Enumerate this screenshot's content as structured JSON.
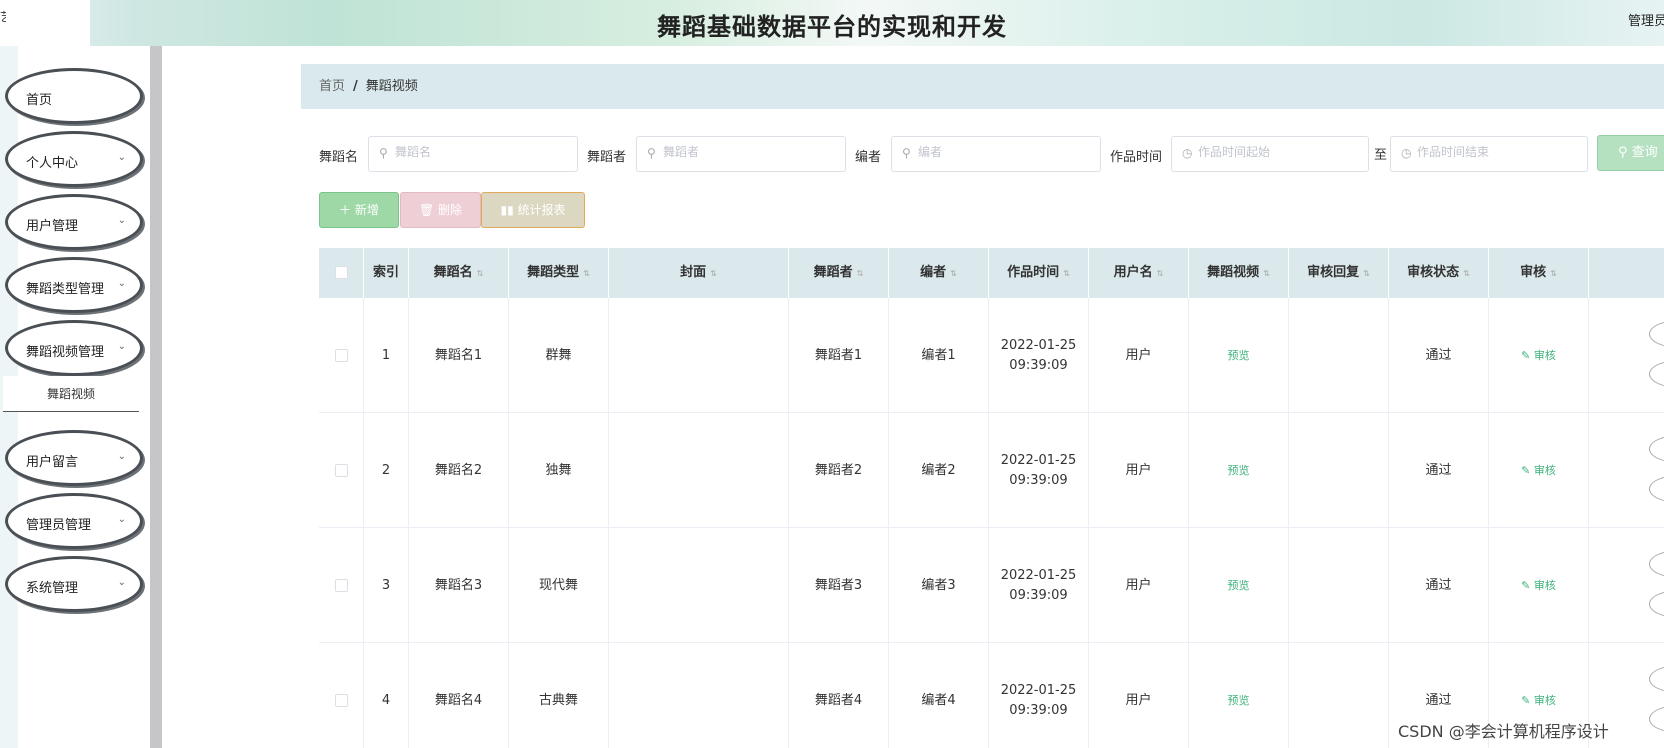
{
  "header": {
    "title": "舞蹈基础数据平台的实现和开发",
    "user_label": "管理员",
    "left_char": "艺"
  },
  "sidebar": {
    "items": [
      {
        "label": "首页",
        "has_caret": false
      },
      {
        "label": "个人中心",
        "has_caret": true
      },
      {
        "label": "用户管理",
        "has_caret": true
      },
      {
        "label": "舞蹈类型管理",
        "has_caret": true
      },
      {
        "label": "舞蹈视频管理",
        "has_caret": true
      },
      {
        "label": "用户留言",
        "has_caret": true
      },
      {
        "label": "管理员管理",
        "has_caret": true
      },
      {
        "label": "系统管理",
        "has_caret": true
      }
    ],
    "submenu": {
      "label": "舞蹈视频"
    },
    "caret_glyph": "⌄"
  },
  "breadcrumb": {
    "home": "首页",
    "separator": "/",
    "current": "舞蹈视频"
  },
  "search": {
    "fields": [
      {
        "label": "舞蹈名",
        "placeholder": "舞蹈名",
        "value": ""
      },
      {
        "label": "舞蹈者",
        "placeholder": "舞蹈者",
        "value": ""
      },
      {
        "label": "编者",
        "placeholder": "编者",
        "value": ""
      },
      {
        "label": "作品时间",
        "placeholder": "作品时间起始",
        "value": ""
      }
    ],
    "range_separator": "至",
    "end_placeholder": "作品时间结束",
    "button_label": "查询"
  },
  "actions": {
    "add": "新增",
    "delete": "删除",
    "report": "统计报表"
  },
  "table": {
    "headers": [
      "",
      "索引",
      "舞蹈名",
      "舞蹈类型",
      "封面",
      "舞蹈者",
      "编者",
      "作品时间",
      "用户名",
      "舞蹈视频",
      "审核回复",
      "审核状态",
      "审核"
    ],
    "rows": [
      {
        "index": "1",
        "name": "舞蹈名1",
        "type": "群舞",
        "cover": "",
        "dancer": "舞蹈者1",
        "editor": "编者1",
        "date": "2022-01-25",
        "time": "09:39:09",
        "user": "用户",
        "video": "预览",
        "reply": "",
        "status": "通过",
        "audit": "审核"
      },
      {
        "index": "2",
        "name": "舞蹈名2",
        "type": "独舞",
        "cover": "",
        "dancer": "舞蹈者2",
        "editor": "编者2",
        "date": "2022-01-25",
        "time": "09:39:09",
        "user": "用户",
        "video": "预览",
        "reply": "",
        "status": "通过",
        "audit": "审核"
      },
      {
        "index": "3",
        "name": "舞蹈名3",
        "type": "现代舞",
        "cover": "",
        "dancer": "舞蹈者3",
        "editor": "编者3",
        "date": "2022-01-25",
        "time": "09:39:09",
        "user": "用户",
        "video": "预览",
        "reply": "",
        "status": "通过",
        "audit": "审核"
      },
      {
        "index": "4",
        "name": "舞蹈名4",
        "type": "古典舞",
        "cover": "",
        "dancer": "舞蹈者4",
        "editor": "编者4",
        "date": "2022-01-25",
        "time": "09:39:09",
        "user": "用户",
        "video": "预览",
        "reply": "",
        "status": "通过",
        "audit": "审核"
      }
    ]
  },
  "watermark": "CSDN @李会计算机程序设计",
  "colors": {
    "breadcrumb_bg": "#dae9ed",
    "table_header_bg": "#dbe9ec",
    "add_button": "#9fd8a7",
    "delete_button": "#eecfd5",
    "report_button": "#dcd7c1",
    "search_button": "#b6e1c1",
    "link_green": "#3eb27a"
  },
  "icons": {
    "search": "search-icon",
    "clock": "clock-icon",
    "plus": "plus-icon",
    "trash": "trash-icon",
    "bar_chart": "bar-chart-icon",
    "edit": "edit-icon",
    "sort": "sort-icon",
    "chevron": "chevron-down-icon"
  }
}
